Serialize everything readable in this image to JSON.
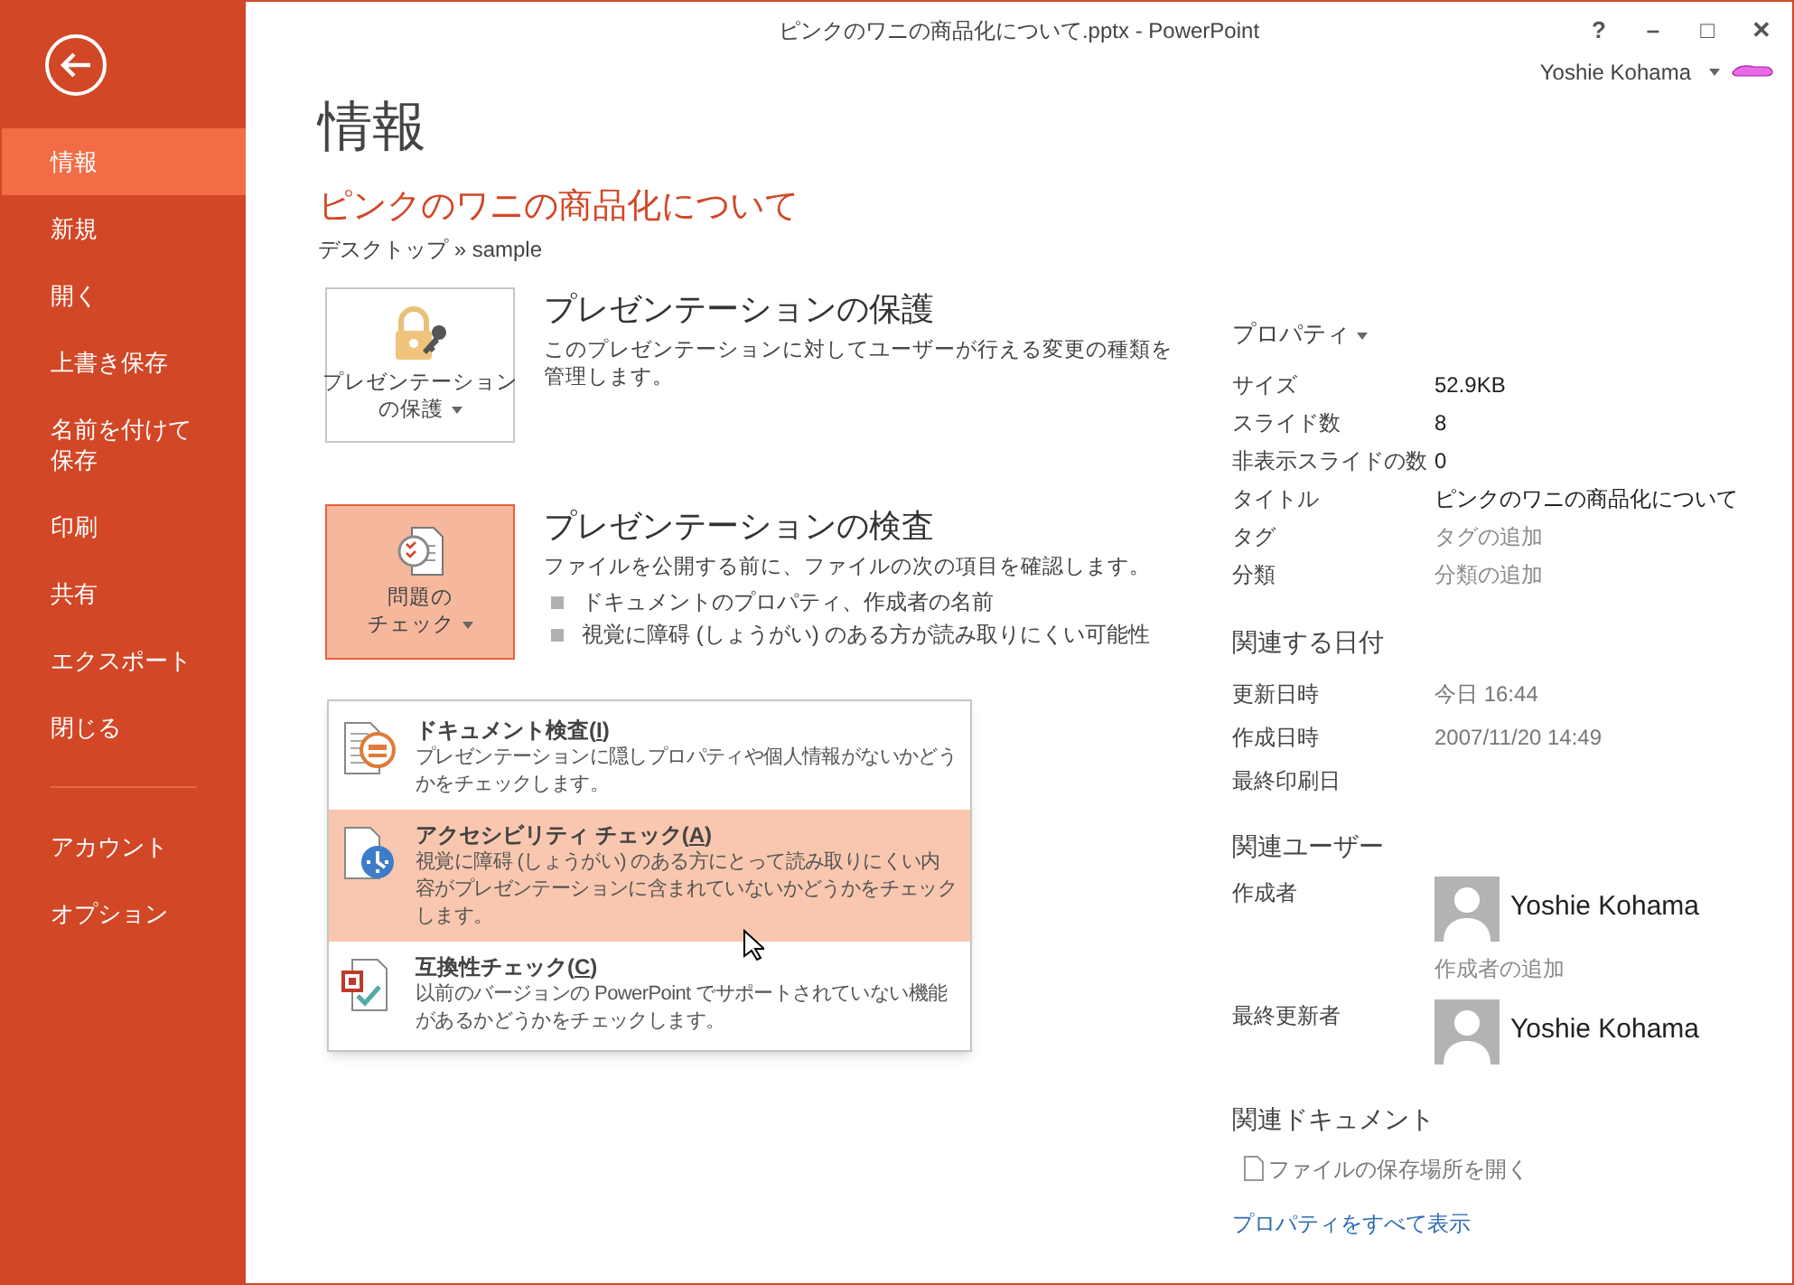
{
  "window": {
    "title": "ピンクのワニの商品化について.pptx - PowerPoint",
    "controls": [
      "?",
      "–",
      "□",
      "✕"
    ],
    "user": "Yoshie Kohama"
  },
  "sidebar": {
    "items": [
      {
        "label": "情報",
        "selected": true
      },
      {
        "label": "新規",
        "selected": false
      },
      {
        "label": "開く",
        "selected": false
      },
      {
        "label": "上書き保存",
        "selected": false
      },
      {
        "lines": [
          "名前を付けて",
          "保存"
        ],
        "selected": false
      },
      {
        "label": "印刷",
        "selected": false
      },
      {
        "label": "共有",
        "selected": false
      },
      {
        "label": "エクスポート",
        "selected": false
      },
      {
        "label": "閉じる",
        "selected": false
      }
    ],
    "bottom_items": [
      {
        "label": "アカウント",
        "selected": false
      },
      {
        "label": "オプション",
        "selected": false
      }
    ]
  },
  "page": {
    "heading": "情報",
    "document_title": "ピンクのワニの商品化について",
    "path": "デスクトップ » sample"
  },
  "sections": [
    {
      "kind": "protect",
      "button": [
        "プレゼンテーション",
        "の保護"
      ],
      "title": "プレゼンテーションの保護",
      "description": "このプレゼンテーションに対してユーザーが行える変更の種類を管理します。",
      "pressed": false
    },
    {
      "kind": "inspect",
      "button": [
        "問題の",
        "チェック"
      ],
      "title": "プレゼンテーションの検査",
      "description": "ファイルを公開する前に、ファイルの次の項目を確認します。",
      "bullets": [
        "ドキュメントのプロパティ、作成者の名前",
        "視覚に障碍 (しょうがい) のある方が読み取りにくい可能性"
      ],
      "pressed": true
    }
  ],
  "menu": {
    "items": [
      {
        "kind": "document",
        "title": "ドキュメント検査(",
        "accelerator": "I",
        "title_end": ")",
        "description": "プレゼンテーションに隠しプロパティや個人情報がないかどうかをチェックします。",
        "selected": false
      },
      {
        "kind": "accessibility",
        "title": "アクセシビリティ チェック(",
        "accelerator": "A",
        "title_end": ")",
        "description": "視覚に障碍 (しょうがい) のある方にとって読み取りにくい内容がプレゼンテーションに含まれていないかどうかをチェックします。",
        "selected": true
      },
      {
        "kind": "compatibility",
        "title": "互換性チェック(",
        "accelerator": "C",
        "title_end": ")",
        "description": "以前のバージョンの PowerPoint でサポートされていない機能があるかどうかをチェックします。",
        "selected": false
      }
    ]
  },
  "properties": {
    "heading": "プロパティ",
    "rows": [
      {
        "label": "サイズ",
        "value": "52.9KB",
        "kind": "value"
      },
      {
        "label": "スライド数",
        "value": "8",
        "kind": "value"
      },
      {
        "label": "非表示スライドの数",
        "value": "0",
        "kind": "value"
      },
      {
        "label": "タイトル",
        "value": "ピンクのワニの商品化について",
        "kind": "value"
      },
      {
        "label": "タグ",
        "value": "タグの追加",
        "kind": "placeholder"
      },
      {
        "label": "分類",
        "value": "分類の追加",
        "kind": "placeholder"
      }
    ]
  },
  "dates": {
    "heading": "関連する日付",
    "rows": [
      {
        "label": "更新日時",
        "value": "今日 16:44"
      },
      {
        "label": "作成日時",
        "value": "2007/11/20 14:49"
      },
      {
        "label": "最終印刷日"
      }
    ]
  },
  "people": {
    "heading": "関連ユーザー",
    "rows": [
      {
        "label": "作成者",
        "name": "Yoshie Kohama",
        "add": "作成者の追加"
      },
      {
        "label": "最終更新者",
        "name": "Yoshie Kohama"
      }
    ]
  },
  "documents": {
    "heading": "関連ドキュメント",
    "open_location": "ファイルの保存場所を開く",
    "show_all": "プロパティをすべて表示"
  }
}
